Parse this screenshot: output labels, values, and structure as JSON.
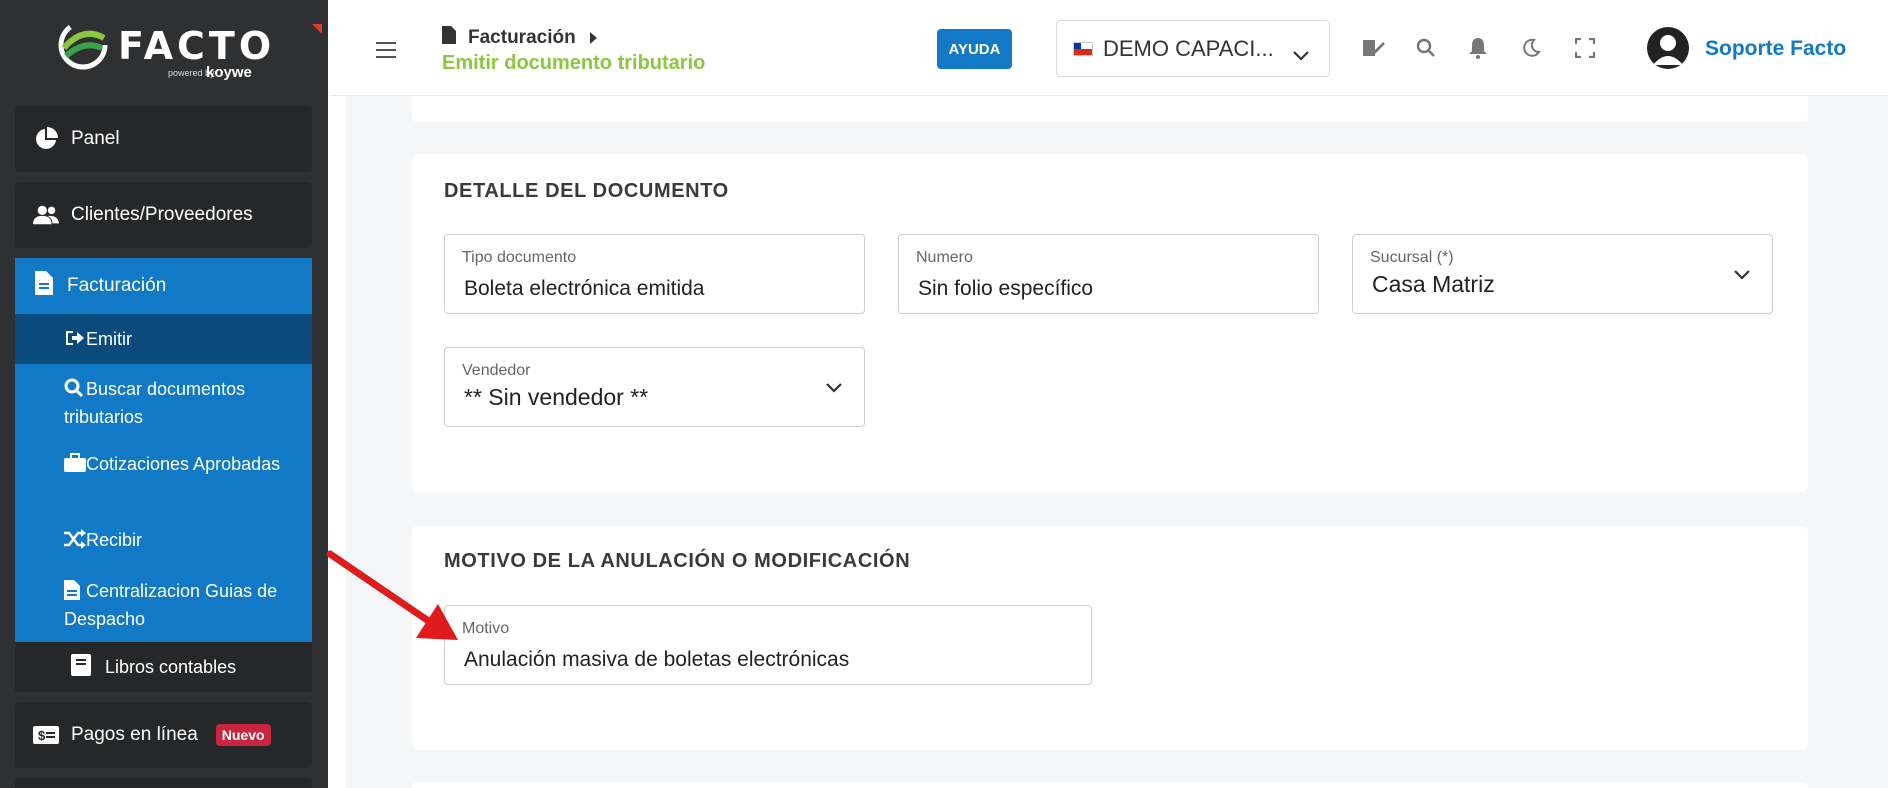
{
  "brand": {
    "logo_text": "FACTO",
    "powered_by": "powered by",
    "partner": "koywe"
  },
  "sidebar": {
    "panel": "Panel",
    "clientes": "Clientes/Proveedores",
    "facturacion": "Facturación",
    "sub_items": {
      "emitir": "Emitir",
      "buscar": "Buscar documentos tributarios",
      "cotizaciones": "Cotizaciones Aprobadas",
      "recibir": "Recibir",
      "centralizacion": "Centralizacion Guias de Despacho",
      "libros": "Libros contables"
    },
    "pagos": "Pagos en línea",
    "pagos_badge": "Nuevo"
  },
  "header": {
    "breadcrumb": "Facturación",
    "subtitle": "Emitir documento tributario",
    "help_label": "AYUDA",
    "company_selector": "DEMO CAPACI...",
    "user_name": "Soporte Facto"
  },
  "detalle": {
    "title": "DETALLE DEL DOCUMENTO",
    "tipo_documento": {
      "label": "Tipo documento",
      "value": "Boleta electrónica emitida"
    },
    "numero": {
      "label": "Numero",
      "value": "Sin folio específico"
    },
    "sucursal": {
      "label": "Sucursal (*)",
      "value": "Casa Matriz"
    },
    "vendedor": {
      "label": "Vendedor",
      "value": "** Sin vendedor **"
    }
  },
  "motivo": {
    "title": "MOTIVO DE LA ANULACIÓN O MODIFICACIÓN",
    "field": {
      "label": "Motivo",
      "value": "Anulación masiva de boletas electrónicas"
    }
  },
  "colors": {
    "sidebar_bg": "#2f3031",
    "accent_blue": "#1279c6",
    "active_blue": "#0b4a7c",
    "subtitle_green": "#8dc63f",
    "badge_red": "#c9253e",
    "annotation_arrow": "#e01b1b"
  }
}
